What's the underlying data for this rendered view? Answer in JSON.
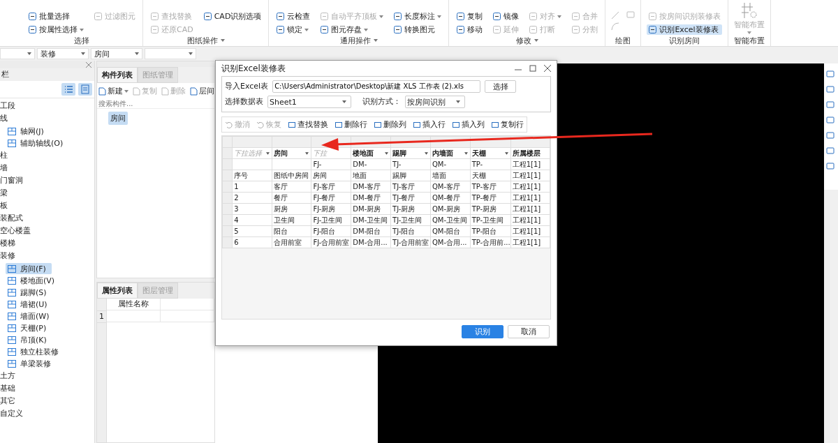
{
  "ribbon": {
    "groups": [
      {
        "kind": "items",
        "label": "选择",
        "dropdown": false,
        "columns": [
          [
            {
              "label": "批量选择",
              "disabled": false,
              "dropdown": false
            },
            {
              "label": "按属性选择",
              "disabled": false,
              "dropdown": true
            }
          ],
          [
            {
              "label": "过滤图元",
              "disabled": true,
              "dropdown": false
            }
          ]
        ]
      },
      {
        "kind": "items",
        "label": "图纸操作",
        "dropdown": true,
        "columns": [
          [
            {
              "label": "查找替换",
              "disabled": true,
              "dropdown": false
            },
            {
              "label": "还原CAD",
              "disabled": true,
              "dropdown": false
            }
          ],
          [
            {
              "label": "CAD识别选项",
              "disabled": false,
              "dropdown": false
            }
          ]
        ]
      },
      {
        "kind": "items",
        "label": "通用操作",
        "dropdown": true,
        "columns": [
          [
            {
              "label": "云检查",
              "disabled": false,
              "dropdown": false
            },
            {
              "label": "锁定",
              "disabled": false,
              "dropdown": true
            }
          ],
          [
            {
              "label": "自动平齐顶板",
              "disabled": true,
              "dropdown": true
            },
            {
              "label": "图元存盘",
              "disabled": false,
              "dropdown": true
            }
          ],
          [
            {
              "label": "长度标注",
              "disabled": false,
              "dropdown": true
            },
            {
              "label": "转换图元",
              "disabled": false,
              "dropdown": false
            }
          ]
        ]
      },
      {
        "kind": "items",
        "label": "修改",
        "dropdown": true,
        "columns": [
          [
            {
              "label": "复制",
              "disabled": false,
              "dropdown": false
            },
            {
              "label": "移动",
              "disabled": false,
              "dropdown": false
            }
          ],
          [
            {
              "label": "镜像",
              "disabled": false,
              "dropdown": false
            },
            {
              "label": "延伸",
              "disabled": true,
              "dropdown": false
            }
          ],
          [
            {
              "label": "对齐",
              "disabled": true,
              "dropdown": true
            },
            {
              "label": "打断",
              "disabled": true,
              "dropdown": false
            }
          ],
          [
            {
              "label": "合并",
              "disabled": true,
              "dropdown": false
            },
            {
              "label": "分割",
              "disabled": true,
              "dropdown": false
            }
          ]
        ]
      },
      {
        "kind": "drawing",
        "label": "绘图",
        "dropdown": false
      },
      {
        "kind": "items",
        "label": "识别房间",
        "dropdown": false,
        "columns": [
          [
            {
              "label": "按房间识别装修表",
              "disabled": true,
              "dropdown": false
            },
            {
              "label": "识别Excel装修表",
              "disabled": false,
              "dropdown": false
            }
          ]
        ]
      },
      {
        "kind": "big",
        "label": "智能布置",
        "dropdown": false,
        "big": {
          "label": "智能布置",
          "disabled": true
        }
      }
    ]
  },
  "filters": [
    {
      "kind": "blank"
    },
    {
      "kind": "text",
      "value": "装修"
    },
    {
      "kind": "text",
      "value": "房间"
    },
    {
      "kind": "blank"
    }
  ],
  "sidebar": {
    "title": "栏",
    "items": [
      {
        "label": "工段"
      },
      {
        "label": "线",
        "children": [
          {
            "label": "轴网(J)",
            "selected": false
          },
          {
            "label": "辅助轴线(O)",
            "selected": false
          }
        ]
      },
      {
        "label": "柱"
      },
      {
        "label": "墙"
      },
      {
        "label": "门窗洞"
      },
      {
        "label": "梁"
      },
      {
        "label": "板"
      },
      {
        "label": "装配式"
      },
      {
        "label": "空心楼盖"
      },
      {
        "label": "楼梯"
      },
      {
        "label": "装修",
        "children": [
          {
            "label": "房间(F)",
            "selected": true
          },
          {
            "label": "楼地面(V)",
            "selected": false
          },
          {
            "label": "踢脚(S)",
            "selected": false
          },
          {
            "label": "墙裙(U)",
            "selected": false
          },
          {
            "label": "墙面(W)",
            "selected": false
          },
          {
            "label": "天棚(P)",
            "selected": false
          },
          {
            "label": "吊顶(K)",
            "selected": false
          },
          {
            "label": "独立柱装修",
            "selected": false
          },
          {
            "label": "单梁装修",
            "selected": false
          }
        ]
      },
      {
        "label": "土方"
      },
      {
        "label": "基础"
      },
      {
        "label": "其它"
      },
      {
        "label": "自定义"
      }
    ]
  },
  "component_panel": {
    "tabs": [
      {
        "label": "构件列表",
        "selected": true
      },
      {
        "label": "图纸管理",
        "selected": false
      }
    ],
    "toolbar": [
      {
        "label": "新建",
        "disabled": false,
        "dropdown": true
      },
      {
        "label": "复制",
        "disabled": true,
        "dropdown": false
      },
      {
        "label": "删除",
        "disabled": true,
        "dropdown": false
      },
      {
        "label": "层间",
        "disabled": false,
        "dropdown": false
      }
    ],
    "search": {
      "placeholder": "搜索构件..."
    },
    "items": [
      {
        "label": "房间",
        "selected": true
      }
    ]
  },
  "property_panel": {
    "tabs": [
      {
        "label": "属性列表",
        "selected": true
      },
      {
        "label": "图层管理",
        "selected": false
      }
    ],
    "columns": [
      "属性名称"
    ],
    "rows": [
      {
        "index": "1"
      }
    ]
  },
  "dialog": {
    "title": "识别Excel装修表",
    "file_label": "导入Excel表",
    "file_path": "C:\\Users\\Administrator\\Desktop\\新建 XLS 工作表 (2).xls",
    "choose_button": "选择",
    "sheet_label": "选择数据表",
    "sheet": "Sheet1",
    "mode_label": "识别方式：",
    "mode": "按房间识别",
    "toolbar": [
      {
        "label": "撤消",
        "disabled": true
      },
      {
        "label": "恢复",
        "disabled": true
      },
      {
        "label": "查找替换",
        "disabled": false
      },
      {
        "label": "删除行",
        "disabled": false
      },
      {
        "label": "删除列",
        "disabled": false
      },
      {
        "label": "插入行",
        "disabled": false
      },
      {
        "label": "插入列",
        "disabled": false
      },
      {
        "label": "复制行",
        "disabled": false
      }
    ],
    "header": [
      {
        "label": "下拉选择",
        "placeholder": true,
        "dropdown": true
      },
      {
        "label": "房间",
        "placeholder": false,
        "dropdown": true
      },
      {
        "label": "下拉",
        "placeholder": true,
        "dropdown": false
      },
      {
        "label": "楼地面",
        "placeholder": false,
        "dropdown": true
      },
      {
        "label": "踢脚",
        "placeholder": false,
        "dropdown": true
      },
      {
        "label": "内墙面",
        "placeholder": false,
        "dropdown": true
      },
      {
        "label": "天棚",
        "placeholder": false,
        "dropdown": true
      },
      {
        "label": "所属楼层",
        "placeholder": false,
        "dropdown": false
      }
    ],
    "rows": [
      [
        null,
        null,
        "FJ-",
        "DM-",
        "TJ-",
        "QM-",
        "TP-",
        "工程1[1]"
      ],
      [
        "序号",
        "图纸中房间",
        "房间",
        "地面",
        "踢脚",
        "墙面",
        "天棚",
        "工程1[1]"
      ],
      [
        "1",
        "客厅",
        "FJ-客厅",
        "DM-客厅",
        "TJ-客厅",
        "QM-客厅",
        "TP-客厅",
        "工程1[1]"
      ],
      [
        "2",
        "餐厅",
        "FJ-餐厅",
        "DM-餐厅",
        "TJ-餐厅",
        "QM-餐厅",
        "TP-餐厅",
        "工程1[1]"
      ],
      [
        "3",
        "厨房",
        "FJ-厨房",
        "DM-厨房",
        "TJ-厨房",
        "QM-厨房",
        "TP-厨房",
        "工程1[1]"
      ],
      [
        "4",
        "卫生间",
        "FJ-卫生间",
        "DM-卫生间",
        "TJ-卫生间",
        "QM-卫生间",
        "TP-卫生间",
        "工程1[1]"
      ],
      [
        "5",
        "阳台",
        "FJ-阳台",
        "DM-阳台",
        "TJ-阳台",
        "QM-阳台",
        "TP-阳台",
        "工程1[1]"
      ],
      [
        "6",
        "合用前室",
        "FJ-合用前室",
        "DM-合用...",
        "TJ-合用前室",
        "QM-合用...",
        "TP-合用前...",
        "工程1[1]"
      ]
    ],
    "buttons": [
      {
        "label": "识别",
        "primary": true
      },
      {
        "label": "取消",
        "primary": false
      }
    ]
  }
}
